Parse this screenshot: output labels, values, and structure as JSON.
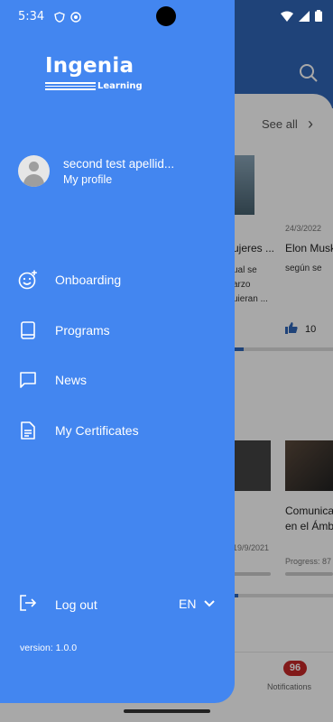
{
  "status_bar": {
    "time": "5:34"
  },
  "drawer": {
    "logo": {
      "name": "Ingenia",
      "sub": "Learning"
    },
    "profile": {
      "name": "second test apellid...",
      "subtitle": "My profile"
    },
    "menu": [
      {
        "label": "Onboarding",
        "icon": "smiley-plus-icon"
      },
      {
        "label": "Programs",
        "icon": "book-icon"
      },
      {
        "label": "News",
        "icon": "chat-bubble-icon"
      },
      {
        "label": "My Certificates",
        "icon": "document-icon"
      }
    ],
    "logout_label": "Log out",
    "language": "EN",
    "version": "version: 1.0.0"
  },
  "background": {
    "see_all": "See all",
    "date_1": "24/3/2022",
    "title_a": "ujeres ...",
    "title_b": "Elon Musk",
    "desc_a": "ual se\narzo\nuieran ...",
    "desc_b": "según se",
    "likes": "10",
    "card_date": "19/9/2021",
    "card_title_b": "Comunica\nen el Ámb",
    "card_progress": "Progress: 87",
    "notifications_count": "96",
    "notifications_label": "Notifications"
  },
  "colors": {
    "drawer": "#4386f0",
    "header": "#2f67b8",
    "badge": "#c62828"
  }
}
